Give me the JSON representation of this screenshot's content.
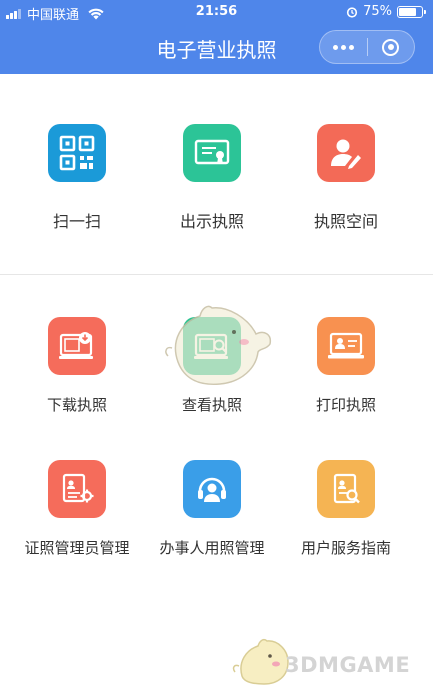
{
  "status_bar": {
    "carrier": "中国联通",
    "time": "21:56",
    "battery": "75%",
    "battery_level": 0.75
  },
  "nav": {
    "title": "电子营业执照"
  },
  "section1": {
    "items": [
      {
        "label": "扫一扫",
        "icon": "qr-scan-icon",
        "color": "#1b9ad8"
      },
      {
        "label": "出示执照",
        "icon": "certificate-icon",
        "color": "#2cc497"
      },
      {
        "label": "执照空间",
        "icon": "user-edit-icon",
        "color": "#f36a57"
      }
    ]
  },
  "section2": {
    "items": [
      {
        "label": "下载执照",
        "icon": "download-license-icon",
        "color": "#f56c5b"
      },
      {
        "label": "查看执照",
        "icon": "view-license-icon",
        "color": "#2ec492"
      },
      {
        "label": "打印执照",
        "icon": "print-license-icon",
        "color": "#f89150"
      },
      {
        "label": "证照管理员管理",
        "icon": "admin-manage-icon",
        "color": "#f56c5b"
      },
      {
        "label": "办事人用照管理",
        "icon": "agent-manage-icon",
        "color": "#3a9ee8"
      },
      {
        "label": "用户服务指南",
        "icon": "service-guide-icon",
        "color": "#f5b453"
      }
    ]
  },
  "watermark": {
    "text": "3DMGAME"
  }
}
